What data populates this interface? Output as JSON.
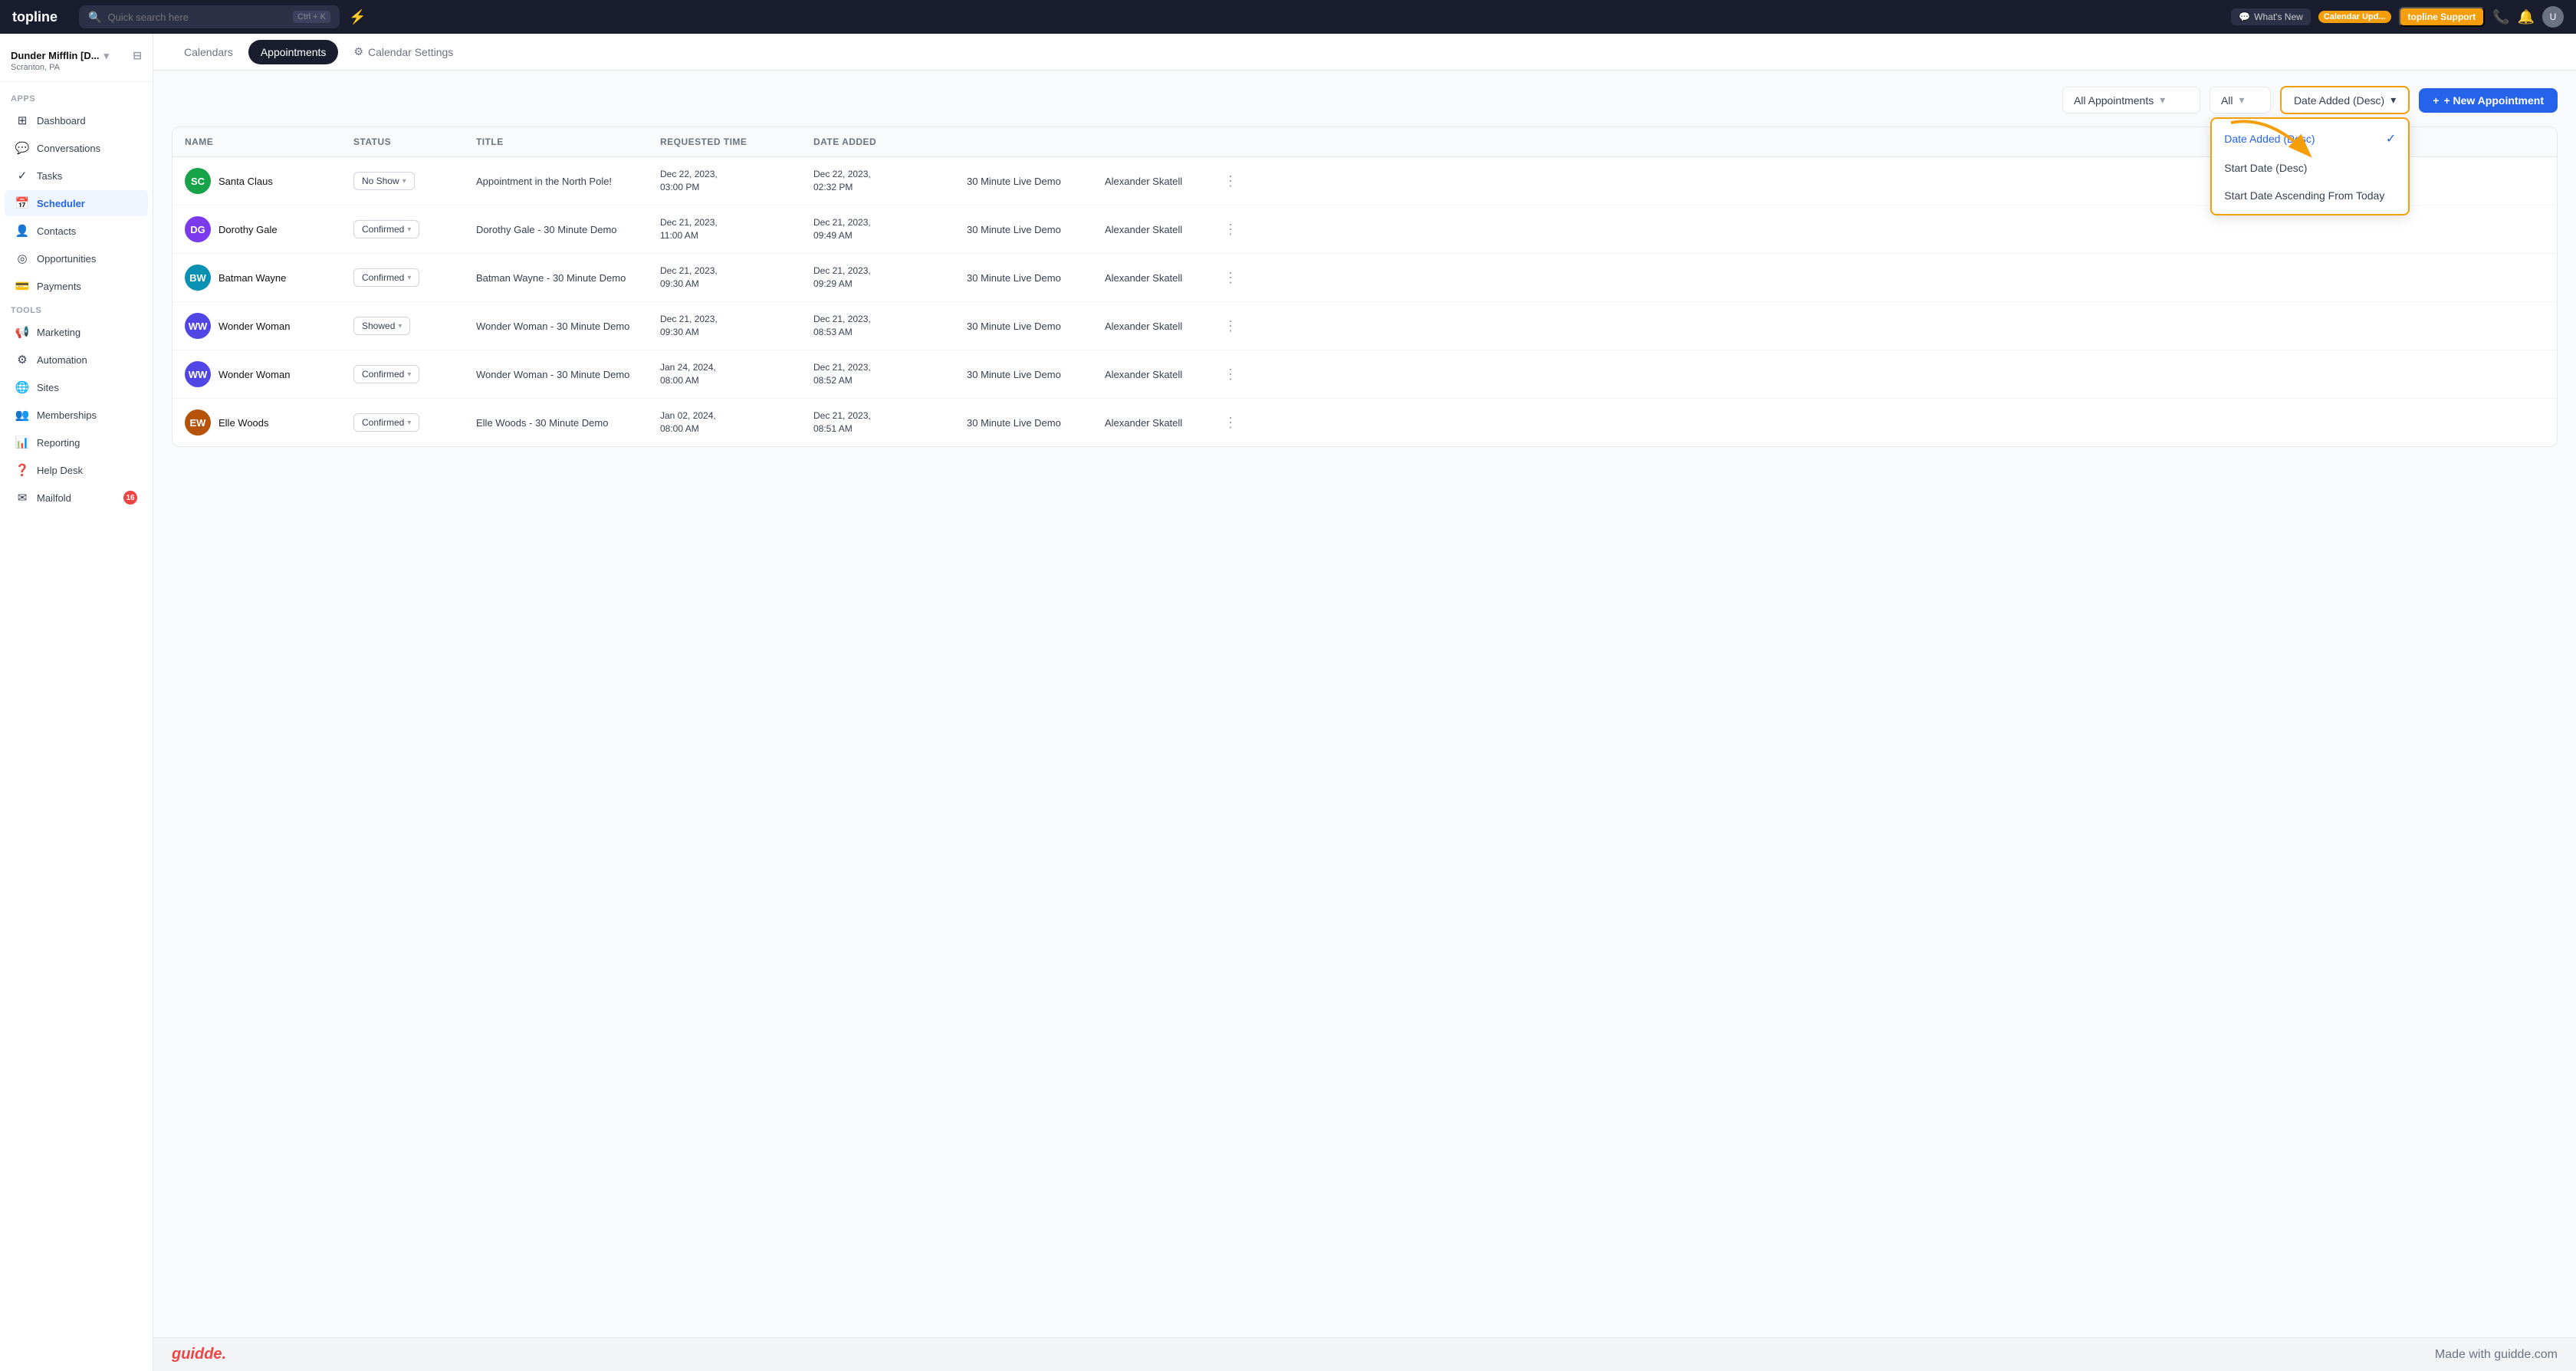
{
  "app": {
    "logo": "topline",
    "search_placeholder": "Quick search here",
    "search_shortcut": "Ctrl + K"
  },
  "topnav": {
    "whats_new_label": "What's New",
    "calendar_update_label": "Calendar Upd...",
    "support_label": "topline Support",
    "lightning_icon": "⚡"
  },
  "sidebar": {
    "workspace_name": "Dunder Mifflin [D...",
    "workspace_location": "Scranton, PA",
    "apps_section": "Apps",
    "tools_section": "Tools",
    "items": [
      {
        "id": "dashboard",
        "label": "Dashboard",
        "icon": "⊞"
      },
      {
        "id": "conversations",
        "label": "Conversations",
        "icon": "💬"
      },
      {
        "id": "tasks",
        "label": "Tasks",
        "icon": "✓"
      },
      {
        "id": "scheduler",
        "label": "Scheduler",
        "icon": "📅",
        "active": true
      },
      {
        "id": "contacts",
        "label": "Contacts",
        "icon": "👤"
      },
      {
        "id": "opportunities",
        "label": "Opportunities",
        "icon": "◎"
      },
      {
        "id": "payments",
        "label": "Payments",
        "icon": "💳"
      },
      {
        "id": "marketing",
        "label": "Marketing",
        "icon": "📢"
      },
      {
        "id": "automation",
        "label": "Automation",
        "icon": "⚙"
      },
      {
        "id": "sites",
        "label": "Sites",
        "icon": "🌐"
      },
      {
        "id": "memberships",
        "label": "Memberships",
        "icon": "👥"
      },
      {
        "id": "reporting",
        "label": "Reporting",
        "icon": "📊"
      },
      {
        "id": "helpdesk",
        "label": "Help Desk",
        "icon": "?"
      },
      {
        "id": "mailfold",
        "label": "Mailfold",
        "icon": "✉",
        "badge": "16"
      }
    ]
  },
  "subheader": {
    "tabs": [
      {
        "id": "calendars",
        "label": "Calendars"
      },
      {
        "id": "appointments",
        "label": "Appointments",
        "active": true
      },
      {
        "id": "calendar_settings",
        "label": "Calendar Settings"
      }
    ]
  },
  "toolbar": {
    "filter_label": "All Appointments",
    "filter_placeholder": "All Appointments",
    "status_filter": "All",
    "sort_label": "Date Added (Desc)",
    "sort_arrow": "▾",
    "new_appt_label": "+ New Appointment"
  },
  "sort_dropdown": {
    "items": [
      {
        "id": "date_added_desc",
        "label": "Date Added (Desc)",
        "selected": true
      },
      {
        "id": "start_date_desc",
        "label": "Start Date (Desc)",
        "selected": false
      },
      {
        "id": "start_date_asc_today",
        "label": "Start Date Ascending From Today",
        "selected": false
      }
    ]
  },
  "table": {
    "columns": [
      "Name",
      "Status",
      "Title",
      "Requested Time",
      "Date Added",
      "",
      "",
      ""
    ],
    "rows": [
      {
        "id": 1,
        "name": "Santa Claus",
        "initials": "SC",
        "avatar_color": "#16a34a",
        "status": "No Show",
        "title": "Appointment in the North Pole!",
        "requested_time": "Dec 22, 2023,\n03:00 PM",
        "date_added": "Dec 22, 2023,\n02:32 PM",
        "calendar": "30 Minute Live Demo",
        "assigned_to": "Alexander Skatell"
      },
      {
        "id": 2,
        "name": "Dorothy Gale",
        "initials": "DG",
        "avatar_color": "#7c3aed",
        "status": "Confirmed",
        "title": "Dorothy Gale - 30 Minute Demo",
        "requested_time": "Dec 21, 2023,\n11:00 AM",
        "date_added": "Dec 21, 2023,\n09:49 AM",
        "calendar": "30 Minute Live Demo",
        "assigned_to": "Alexander Skatell"
      },
      {
        "id": 3,
        "name": "Batman Wayne",
        "initials": "BW",
        "avatar_color": "#0891b2",
        "status": "Confirmed",
        "title": "Batman Wayne - 30 Minute Demo",
        "requested_time": "Dec 21, 2023,\n09:30 AM",
        "date_added": "Dec 21, 2023,\n09:29 AM",
        "calendar": "30 Minute Live Demo",
        "assigned_to": "Alexander Skatell"
      },
      {
        "id": 4,
        "name": "Wonder Woman",
        "initials": "WW",
        "avatar_color": "#4f46e5",
        "status": "Showed",
        "title": "Wonder Woman - 30 Minute Demo",
        "requested_time": "Dec 21, 2023,\n09:30 AM",
        "date_added": "Dec 21, 2023,\n08:53 AM",
        "calendar": "30 Minute Live Demo",
        "assigned_to": "Alexander Skatell"
      },
      {
        "id": 5,
        "name": "Wonder Woman",
        "initials": "WW",
        "avatar_color": "#4f46e5",
        "status": "Confirmed",
        "title": "Wonder Woman - 30 Minute Demo",
        "requested_time": "Jan 24, 2024,\n08:00 AM",
        "date_added": "Dec 21, 2023,\n08:52 AM",
        "calendar": "30 Minute Live Demo",
        "assigned_to": "Alexander Skatell"
      },
      {
        "id": 6,
        "name": "Elle Woods",
        "initials": "EW",
        "avatar_color": "#b45309",
        "status": "Confirmed",
        "title": "Elle Woods - 30 Minute Demo",
        "requested_time": "Jan 02, 2024,\n08:00 AM",
        "date_added": "Dec 21, 2023,\n08:51 AM",
        "calendar": "30 Minute Live Demo",
        "assigned_to": "Alexander Skatell"
      }
    ]
  },
  "footer": {
    "logo": "guidde.",
    "text": "Made with guidde.com"
  }
}
